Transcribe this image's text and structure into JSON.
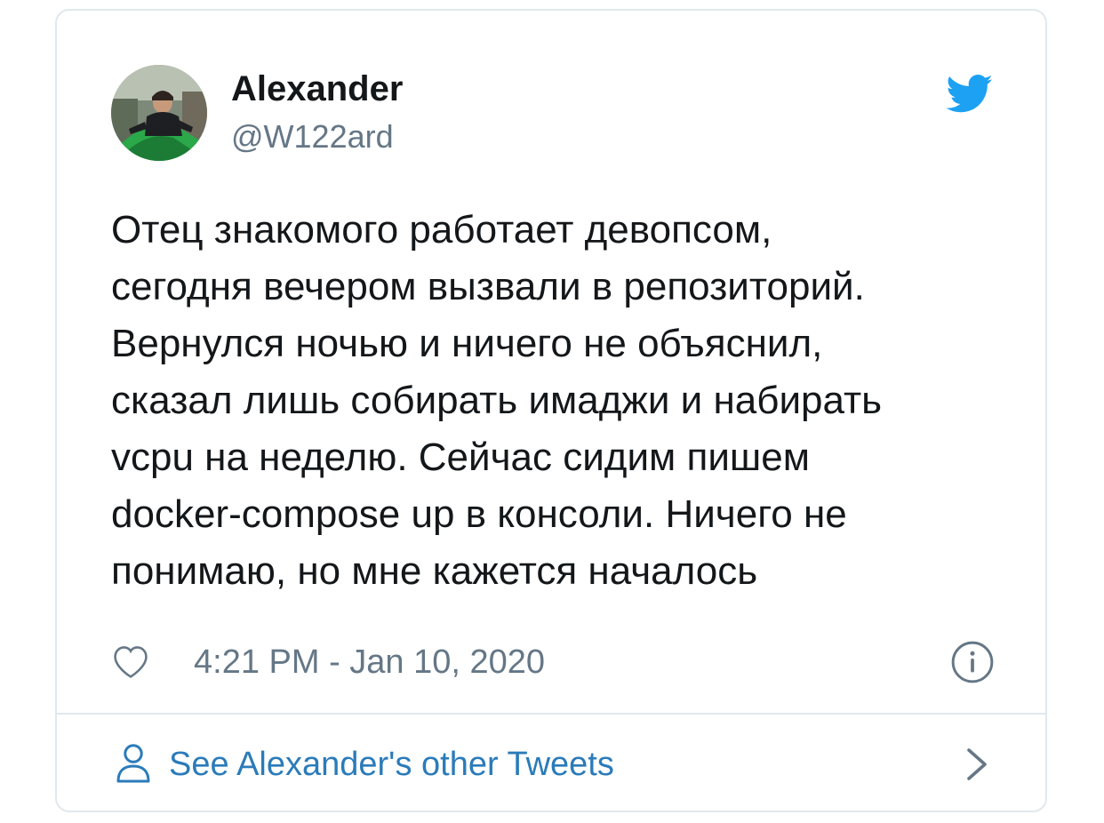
{
  "author": {
    "name": "Alexander",
    "handle": "@W122ard"
  },
  "tweet": {
    "text": "Отец знакомого работает девопсом,\nсегодня вечером вызвали в репозиторий.\nВернулся ночью и ничего не объяснил,\nсказал лишь собирать имаджи и набирать\nvcpu на неделю. Сейчас сидим пишем\ndocker-compose up в консоли. Ничего не\nпонимаю, но мне кажется началось",
    "timestamp": "4:21 PM - Jan 10, 2020"
  },
  "footer": {
    "link_label": "See Alexander's other Tweets"
  },
  "icons": {
    "brand": "twitter-bird-icon",
    "like": "heart-icon",
    "info": "info-icon",
    "profile": "person-icon",
    "more": "chevron-right-icon"
  },
  "colors": {
    "twitter_blue": "#1da1f2",
    "link_blue": "#2b7bb9",
    "secondary_text": "#657786",
    "border": "#e1e8ed"
  }
}
